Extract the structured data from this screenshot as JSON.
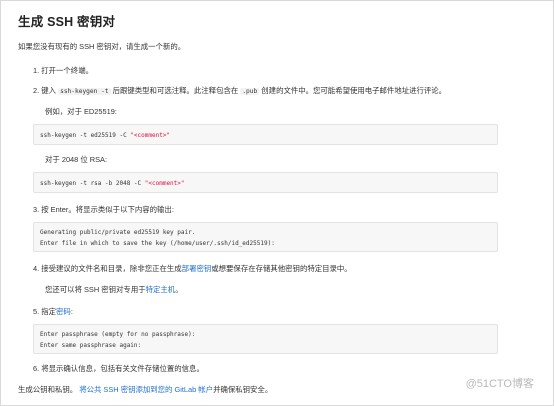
{
  "title": "生成 SSH 密钥对",
  "intro": "如果您没有现有的 SSH 密钥对，请生成一个新的。",
  "steps": {
    "s1": {
      "num": "1.",
      "text": "打开一个终端。"
    },
    "s2": {
      "num": "2.",
      "pre": "键入",
      "code": "ssh-keygen -t",
      "post": "后跟键类型和可选注释。此注释包含在",
      "code2": ".pub",
      "post2": "创建的文件中。您可能希望使用电子邮件地址进行评论。",
      "ex1_label": "例如，对于 ED25519:",
      "ex1_cmd": "ssh-keygen -t ed25519 -C ",
      "ex1_arg": "\"<comment>\"",
      "ex2_label": "对于 2048 位 RSA:",
      "ex2_cmd": "ssh-keygen -t rsa -b 2048 -C ",
      "ex2_arg": "\"<comment>\""
    },
    "s3": {
      "num": "3.",
      "text": "按 Enter。将显示类似于以下内容的输出:",
      "out1": "Generating public/private ed25519 key pair.",
      "out2": "Enter file in which to save the key (/home/user/.ssh/id_ed25519):"
    },
    "s4": {
      "num": "4.",
      "pre": "接受建议的文件名和目录，除非您正在生成",
      "link": "部署密钥",
      "post": "或想要保存在存储其他密钥的特定目录中。",
      "sub_pre": "您还可以将 SSH 密钥对专用于",
      "sub_link": "特定主机",
      "sub_post": "。"
    },
    "s5": {
      "num": "5.",
      "pre": "指定",
      "link": "密码",
      "post": ":",
      "out1": "Enter passphrase (empty for no passphrase):",
      "out2": "Enter same passphrase again:"
    },
    "s6": {
      "num": "6.",
      "text": "将显示确认信息，包括有关文件存储位置的信息。"
    }
  },
  "outro": {
    "pre": "生成公钥和私钥。",
    "link": "将公共 SSH 密钥添加到您的 GitLab 帐户",
    "post": "并确保私钥安全。"
  },
  "watermark": "@51CTO博客",
  "colors": {
    "link": "#1f6fd1",
    "string": "#dd1144",
    "code_bg": "#f7f7f7"
  }
}
